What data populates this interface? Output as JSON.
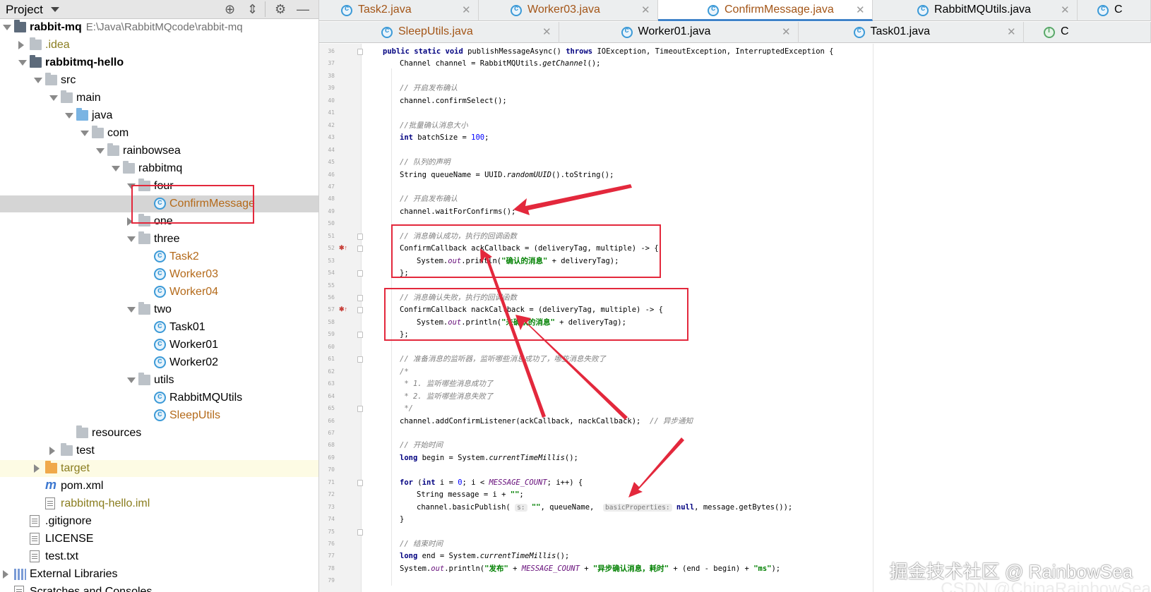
{
  "project_panel": {
    "title": "Project",
    "tree": [
      {
        "label": "rabbit-mq",
        "path": "E:\\Java\\RabbitMQcode\\rabbit-mq",
        "depth": 0,
        "expand": "down",
        "icon": "module-folder-icon",
        "bold": true
      },
      {
        "label": ".idea",
        "depth": 1,
        "expand": "right",
        "icon": "folder-icon",
        "color": "olive"
      },
      {
        "label": "rabbitmq-hello",
        "depth": 1,
        "expand": "down",
        "icon": "module-folder-icon",
        "bold": true
      },
      {
        "label": "src",
        "depth": 2,
        "expand": "down",
        "icon": "folder-icon"
      },
      {
        "label": "main",
        "depth": 3,
        "expand": "down",
        "icon": "folder-icon"
      },
      {
        "label": "java",
        "depth": 4,
        "expand": "down",
        "icon": "source-folder-icon"
      },
      {
        "label": "com",
        "depth": 5,
        "expand": "down",
        "icon": "package-icon"
      },
      {
        "label": "rainbowsea",
        "depth": 6,
        "expand": "down",
        "icon": "package-icon"
      },
      {
        "label": "rabbitmq",
        "depth": 7,
        "expand": "down",
        "icon": "package-icon"
      },
      {
        "label": "four",
        "depth": 8,
        "expand": "down",
        "icon": "package-icon"
      },
      {
        "label": "ConfirmMessage",
        "depth": 9,
        "icon": "java-class-icon",
        "color": "orange",
        "selected": true
      },
      {
        "label": "one",
        "depth": 8,
        "expand": "right",
        "icon": "package-icon"
      },
      {
        "label": "three",
        "depth": 8,
        "expand": "down",
        "icon": "package-icon"
      },
      {
        "label": "Task2",
        "depth": 9,
        "icon": "java-class-icon",
        "color": "orange"
      },
      {
        "label": "Worker03",
        "depth": 9,
        "icon": "java-class-icon",
        "color": "orange"
      },
      {
        "label": "Worker04",
        "depth": 9,
        "icon": "java-class-icon",
        "color": "orange"
      },
      {
        "label": "two",
        "depth": 8,
        "expand": "down",
        "icon": "package-icon"
      },
      {
        "label": "Task01",
        "depth": 9,
        "icon": "java-class-icon"
      },
      {
        "label": "Worker01",
        "depth": 9,
        "icon": "java-class-icon"
      },
      {
        "label": "Worker02",
        "depth": 9,
        "icon": "java-class-icon"
      },
      {
        "label": "utils",
        "depth": 8,
        "expand": "down",
        "icon": "package-icon"
      },
      {
        "label": "RabbitMQUtils",
        "depth": 9,
        "icon": "java-class-icon"
      },
      {
        "label": "SleepUtils",
        "depth": 9,
        "icon": "java-class-icon",
        "color": "orange"
      },
      {
        "label": "resources",
        "depth": 4,
        "icon": "resources-folder-icon"
      },
      {
        "label": "test",
        "depth": 3,
        "expand": "right",
        "icon": "folder-icon"
      },
      {
        "label": "target",
        "depth": 2,
        "expand": "right",
        "icon": "excluded-folder-icon",
        "color": "olive",
        "highlight": true
      },
      {
        "label": "pom.xml",
        "depth": 2,
        "icon": "maven-icon"
      },
      {
        "label": "rabbitmq-hello.iml",
        "depth": 2,
        "icon": "file-icon",
        "color": "olive"
      },
      {
        "label": ".gitignore",
        "depth": 1,
        "icon": "file-icon"
      },
      {
        "label": "LICENSE",
        "depth": 1,
        "icon": "file-icon"
      },
      {
        "label": "test.txt",
        "depth": 1,
        "icon": "file-icon"
      },
      {
        "label": "External Libraries",
        "depth": 0,
        "expand": "right",
        "icon": "library-icon"
      },
      {
        "label": "Scratches and Consoles",
        "depth": 0,
        "icon": "scratch-icon"
      }
    ]
  },
  "tabs": {
    "row1": [
      {
        "label": "Task2.java",
        "color": "brown"
      },
      {
        "label": "Worker03.java",
        "color": "brown"
      },
      {
        "label": "ConfirmMessage.java",
        "color": "brown",
        "active": true
      },
      {
        "label": "RabbitMQUtils.java",
        "color": "dark"
      },
      {
        "label": "C",
        "color": "dark"
      }
    ],
    "row2": [
      {
        "label": "SleepUtils.java",
        "color": "brown"
      },
      {
        "label": "Worker01.java",
        "color": "dark"
      },
      {
        "label": "Task01.java",
        "color": "dark"
      },
      {
        "label": "C",
        "color": "dark"
      }
    ]
  },
  "editor": {
    "lines": [
      {
        "n": "36",
        "indent": 0,
        "code": [
          [
            "k",
            "public static void "
          ],
          [
            "",
            "publishMessageAsync() "
          ],
          [
            "k",
            "throws "
          ],
          [
            "",
            "IOException, TimeoutException, InterruptedException {"
          ]
        ]
      },
      {
        "n": "37",
        "indent": 1,
        "code": [
          [
            "",
            "Channel channel = RabbitMQUtils."
          ],
          [
            "mi",
            "getChannel"
          ],
          [
            "",
            "();"
          ]
        ]
      },
      {
        "n": "38",
        "indent": 0,
        "code": []
      },
      {
        "n": "39",
        "indent": 1,
        "code": [
          [
            "cm",
            "// 开启发布确认"
          ]
        ]
      },
      {
        "n": "40",
        "indent": 1,
        "code": [
          [
            "",
            "channel.confirmSelect();"
          ]
        ]
      },
      {
        "n": "41",
        "indent": 0,
        "code": []
      },
      {
        "n": "42",
        "indent": 1,
        "code": [
          [
            "cm",
            "//批量确认消息大小"
          ]
        ]
      },
      {
        "n": "43",
        "indent": 1,
        "code": [
          [
            "k",
            "int "
          ],
          [
            "",
            "batchSize = "
          ],
          [
            "nm",
            "100"
          ],
          [
            "",
            ";"
          ]
        ]
      },
      {
        "n": "44",
        "indent": 0,
        "code": []
      },
      {
        "n": "45",
        "indent": 1,
        "code": [
          [
            "cm",
            "// 队列的声明"
          ]
        ]
      },
      {
        "n": "46",
        "indent": 1,
        "code": [
          [
            "",
            "String queueName = UUID."
          ],
          [
            "mi",
            "randomUUID"
          ],
          [
            "",
            "().toString();"
          ]
        ]
      },
      {
        "n": "47",
        "indent": 0,
        "code": []
      },
      {
        "n": "48",
        "indent": 1,
        "code": [
          [
            "cm",
            "// 开启发布确认"
          ]
        ]
      },
      {
        "n": "49",
        "indent": 1,
        "code": [
          [
            "",
            "channel.waitForConfirms();"
          ]
        ]
      },
      {
        "n": "50",
        "indent": 0,
        "code": []
      },
      {
        "n": "51",
        "indent": 1,
        "code": [
          [
            "cm",
            "// 消息确认成功，执行的回调函数"
          ]
        ]
      },
      {
        "n": "52",
        "indent": 1,
        "mark": "lambda",
        "code": [
          [
            "",
            "ConfirmCallback ackCallback = (deliveryTag, multiple) -> {"
          ]
        ]
      },
      {
        "n": "53",
        "indent": 2,
        "code": [
          [
            "",
            "System."
          ],
          [
            "fi",
            "out"
          ],
          [
            "",
            ".println("
          ],
          [
            "st",
            "\"确认的消息\""
          ],
          [
            "",
            " + deliveryTag);"
          ]
        ]
      },
      {
        "n": "54",
        "indent": 1,
        "code": [
          [
            "",
            "};"
          ]
        ]
      },
      {
        "n": "55",
        "indent": 0,
        "code": []
      },
      {
        "n": "56",
        "indent": 1,
        "code": [
          [
            "cm",
            "// 消息确认失败，执行的回调函数"
          ]
        ]
      },
      {
        "n": "57",
        "indent": 1,
        "mark": "lambda",
        "code": [
          [
            "",
            "ConfirmCallback nackCallback = (deliveryTag, multiple) -> {"
          ]
        ]
      },
      {
        "n": "58",
        "indent": 2,
        "code": [
          [
            "",
            "System."
          ],
          [
            "fi",
            "out"
          ],
          [
            "",
            ".println("
          ],
          [
            "st",
            "\"未确认的消息\""
          ],
          [
            "",
            " + deliveryTag);"
          ]
        ]
      },
      {
        "n": "59",
        "indent": 1,
        "code": [
          [
            "",
            "};"
          ]
        ]
      },
      {
        "n": "60",
        "indent": 0,
        "code": []
      },
      {
        "n": "61",
        "indent": 1,
        "code": [
          [
            "cm",
            "// 准备消息的监听器，监听哪些消息成功了，哪些消息失败了"
          ]
        ]
      },
      {
        "n": "62",
        "indent": 1,
        "code": [
          [
            "cm",
            "/*"
          ]
        ]
      },
      {
        "n": "63",
        "indent": 1,
        "code": [
          [
            "cm",
            " * 1. 监听哪些消息成功了"
          ]
        ]
      },
      {
        "n": "64",
        "indent": 1,
        "code": [
          [
            "cm",
            " * 2. 监听哪些消息失败了"
          ]
        ]
      },
      {
        "n": "65",
        "indent": 1,
        "code": [
          [
            "cm",
            " */"
          ]
        ]
      },
      {
        "n": "66",
        "indent": 1,
        "code": [
          [
            "",
            "channel.addConfirmListener(ackCallback, nackCallback);  "
          ],
          [
            "cm",
            "// 异步通知"
          ]
        ]
      },
      {
        "n": "67",
        "indent": 0,
        "code": []
      },
      {
        "n": "68",
        "indent": 1,
        "code": [
          [
            "cm",
            "// 开始时间"
          ]
        ]
      },
      {
        "n": "69",
        "indent": 1,
        "code": [
          [
            "k",
            "long "
          ],
          [
            "",
            "begin = System."
          ],
          [
            "mi",
            "currentTimeMillis"
          ],
          [
            "",
            "();"
          ]
        ]
      },
      {
        "n": "70",
        "indent": 0,
        "code": []
      },
      {
        "n": "71",
        "indent": 1,
        "code": [
          [
            "k",
            "for "
          ],
          [
            "",
            "("
          ],
          [
            "k",
            "int "
          ],
          [
            "",
            "i = "
          ],
          [
            "nm",
            "0"
          ],
          [
            "",
            "; i < "
          ],
          [
            "fi",
            "MESSAGE_COUNT"
          ],
          [
            "",
            "; i++) {"
          ]
        ]
      },
      {
        "n": "72",
        "indent": 2,
        "code": [
          [
            "",
            "String message = i + "
          ],
          [
            "st",
            "\"\""
          ],
          [
            "",
            ";"
          ]
        ]
      },
      {
        "n": "73",
        "indent": 2,
        "code": [
          [
            "",
            "channel.basicPublish( "
          ],
          [
            "hint",
            "s:"
          ],
          [
            "",
            " "
          ],
          [
            "st",
            "\"\""
          ],
          [
            "",
            ", queueName,  "
          ],
          [
            "hint",
            "basicProperties:"
          ],
          [
            "",
            " "
          ],
          [
            "k",
            "null"
          ],
          [
            "",
            ", message.getBytes());"
          ]
        ]
      },
      {
        "n": "74",
        "indent": 1,
        "code": [
          [
            "",
            "}"
          ]
        ]
      },
      {
        "n": "75",
        "indent": 0,
        "code": []
      },
      {
        "n": "76",
        "indent": 1,
        "code": [
          [
            "cm",
            "// 结束时间"
          ]
        ]
      },
      {
        "n": "77",
        "indent": 1,
        "code": [
          [
            "k",
            "long "
          ],
          [
            "",
            "end = System."
          ],
          [
            "mi",
            "currentTimeMillis"
          ],
          [
            "",
            "();"
          ]
        ]
      },
      {
        "n": "78",
        "indent": 1,
        "code": [
          [
            "",
            "System."
          ],
          [
            "fi",
            "out"
          ],
          [
            "",
            ".println("
          ],
          [
            "st",
            "\"发布\""
          ],
          [
            "",
            " + "
          ],
          [
            "fi",
            "MESSAGE_COUNT"
          ],
          [
            "",
            " + "
          ],
          [
            "st",
            "\"异步确认消息，耗时\""
          ],
          [
            "",
            " + (end - begin) + "
          ],
          [
            "st",
            "\"ms\""
          ],
          [
            "",
            ");"
          ]
        ]
      },
      {
        "n": "79",
        "indent": 0,
        "code": []
      }
    ]
  },
  "watermark": "掘金技术社区 @ RainbowSea",
  "watermark_faint": "CSDN @ChinaRainbowSea",
  "colors": {
    "annotation": "#e3283c",
    "tab_accent": "#4083c9"
  }
}
